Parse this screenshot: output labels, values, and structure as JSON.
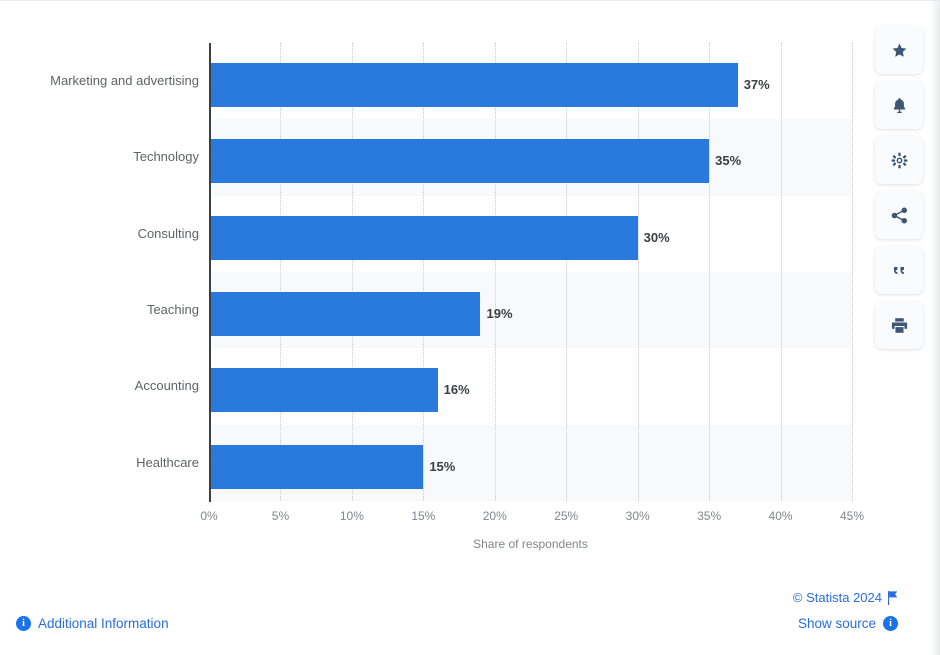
{
  "chart_data": {
    "type": "bar",
    "orientation": "horizontal",
    "title": "",
    "subtitle": "",
    "xlabel": "Share of respondents",
    "ylabel": "",
    "categories": [
      "Marketing and advertising",
      "Technology",
      "Consulting",
      "Teaching",
      "Accounting",
      "Healthcare"
    ],
    "values": [
      37,
      35,
      30,
      19,
      16,
      15
    ],
    "value_labels": [
      "37%",
      "35%",
      "30%",
      "19%",
      "16%",
      "15%"
    ],
    "xlim": [
      0,
      45
    ],
    "xticks": [
      0,
      5,
      10,
      15,
      20,
      25,
      30,
      35,
      40,
      45
    ],
    "xtick_labels": [
      "0%",
      "5%",
      "10%",
      "15%",
      "20%",
      "25%",
      "30%",
      "35%",
      "40%",
      "45%"
    ],
    "grid": "vertical-dotted",
    "legend": "none",
    "bar_color": "#2a7ade",
    "band_color": "#f8f9fa",
    "axis_color": "#3c4043",
    "tick_label_color": "#80868b",
    "category_label_color": "#5f6368",
    "value_label_color": "#3c4043"
  },
  "toolbar": {
    "items": [
      {
        "name": "star-icon",
        "label": "Add to favorites"
      },
      {
        "name": "bell-icon",
        "label": "Notifications"
      },
      {
        "name": "gear-icon",
        "label": "Settings"
      },
      {
        "name": "share-icon",
        "label": "Share"
      },
      {
        "name": "quote-icon",
        "label": "Citation"
      },
      {
        "name": "print-icon",
        "label": "Print"
      }
    ]
  },
  "footer": {
    "copyright": "© Statista 2024",
    "additional_information": "Additional Information",
    "show_source": "Show source",
    "info_badge_glyph": "i",
    "link_color": "#2a6ce0"
  }
}
